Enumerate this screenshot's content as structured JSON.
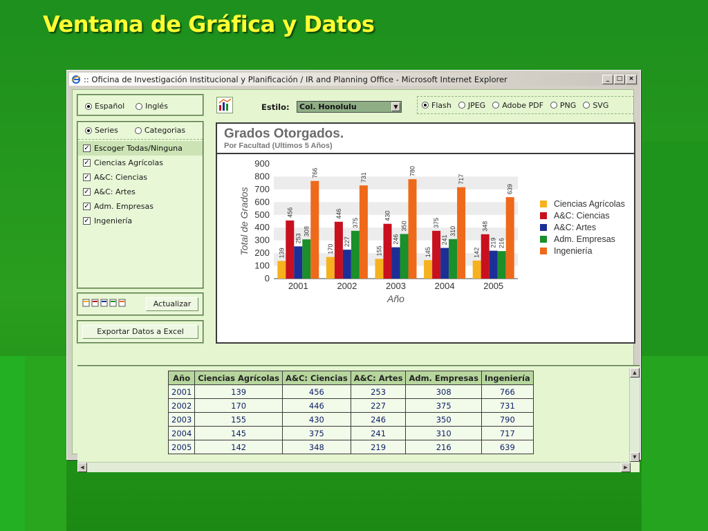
{
  "slide": {
    "title": "Ventana de Gráfica y Datos"
  },
  "window": {
    "title": ":: Oficina de Investigación Institucional y Planificación / IR and Planning Office - Microsoft Internet Explorer"
  },
  "language": {
    "options": [
      "Español",
      "Inglés"
    ],
    "selected": "Español"
  },
  "mode": {
    "options": [
      "Series",
      "Categorias"
    ],
    "selected": "Series"
  },
  "series_list": [
    {
      "label": "Escoger Todas/Ninguna",
      "checked": true
    },
    {
      "label": "Ciencias Agrícolas",
      "checked": true
    },
    {
      "label": "A&C: Ciencias",
      "checked": true
    },
    {
      "label": "A&C: Artes",
      "checked": true
    },
    {
      "label": "Adm. Empresas",
      "checked": true
    },
    {
      "label": "Ingeniería",
      "checked": true
    }
  ],
  "actions": {
    "update_label": "Actualizar",
    "export_label": "Exportar Datos a Excel"
  },
  "toolbar": {
    "style_label": "Estilo:",
    "style_value": "Col. Honolulu"
  },
  "formats": {
    "options": [
      "Flash",
      "JPEG",
      "Adobe PDF",
      "PNG",
      "SVG"
    ],
    "selected": "Flash"
  },
  "chart_data": {
    "type": "bar",
    "title": "Grados Otorgados.",
    "subtitle": "Por Facultad (Ultimos 5 Años)",
    "xlabel": "Año",
    "ylabel": "Total de Grados",
    "ylim": [
      0,
      900
    ],
    "yticks": [
      0,
      100,
      200,
      300,
      400,
      500,
      600,
      700,
      800,
      900
    ],
    "categories": [
      "2001",
      "2002",
      "2003",
      "2004",
      "2005"
    ],
    "series": [
      {
        "name": "Ciencias Agrícolas",
        "color": "#f5b21e",
        "values": [
          139,
          170,
          155,
          145,
          142
        ]
      },
      {
        "name": "A&C: Ciencias",
        "color": "#c8101e",
        "values": [
          456,
          446,
          430,
          375,
          348
        ]
      },
      {
        "name": "A&C: Artes",
        "color": "#1c2f96",
        "values": [
          253,
          227,
          246,
          241,
          219
        ]
      },
      {
        "name": "Adm. Empresas",
        "color": "#1a8f2a",
        "values": [
          308,
          375,
          350,
          310,
          216
        ]
      },
      {
        "name": "Ingeniería",
        "color": "#ee6a1a",
        "values": [
          766,
          731,
          780,
          717,
          639
        ]
      }
    ],
    "legend": "right",
    "grid": "alternating bands"
  },
  "table": {
    "headers": [
      "Año",
      "Ciencias Agrícolas",
      "A&C: Ciencias",
      "A&C: Artes",
      "Adm. Empresas",
      "Ingeniería"
    ],
    "rows": [
      [
        "2001",
        "139",
        "456",
        "253",
        "308",
        "766"
      ],
      [
        "2002",
        "170",
        "446",
        "227",
        "375",
        "731"
      ],
      [
        "2003",
        "155",
        "430",
        "246",
        "350",
        "790"
      ],
      [
        "2004",
        "145",
        "375",
        "241",
        "310",
        "717"
      ],
      [
        "2005",
        "142",
        "348",
        "219",
        "216",
        "639"
      ]
    ]
  }
}
